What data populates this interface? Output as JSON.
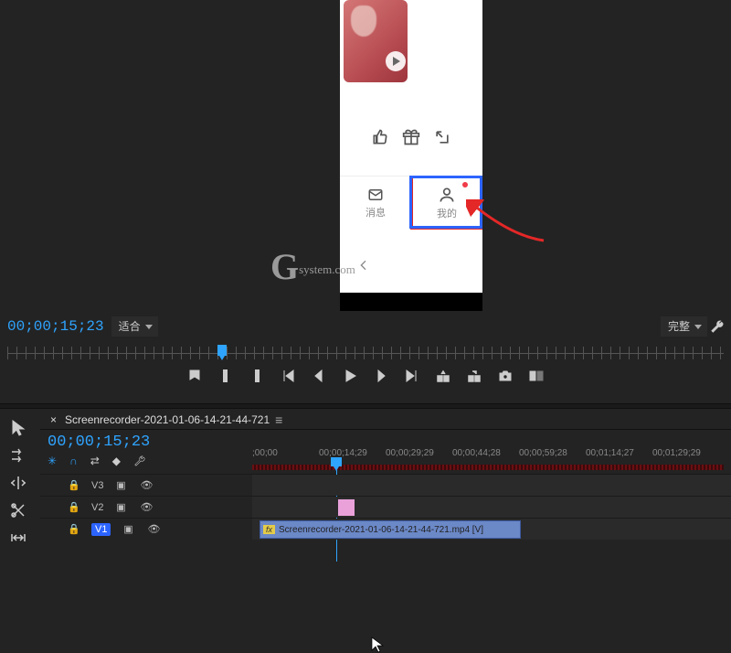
{
  "program": {
    "timecode": "00;00;15;23",
    "fit_label": "适合",
    "full_label": "完整",
    "nav_msg": "消息",
    "nav_mine": "我的",
    "watermark_main": "G",
    "watermark_sub": "system.com"
  },
  "transport": {
    "marker": "marker-icon",
    "in": "in-icon",
    "out": "out-icon",
    "goto_in": "goto-in-icon",
    "step_back": "step-back-icon",
    "play": "play-icon",
    "step_fwd": "step-fwd-icon",
    "goto_out": "goto-out-icon",
    "lift": "lift-icon",
    "extract": "extract-icon",
    "export_frame": "camera-icon",
    "compare": "compare-icon"
  },
  "timeline": {
    "sequence_name": "Screenrecorder-2021-01-06-14-21-44-721",
    "timecode": "00;00;15;23",
    "ruler": [
      ";00;00",
      "00;00;14;29",
      "00;00;29;29",
      "00;00;44;28",
      "00;00;59;28",
      "00;01;14;27",
      "00;01;29;29"
    ],
    "tracks": {
      "v3": "V3",
      "v2": "V2",
      "v1": "V1"
    },
    "clip_label": "Screenrecorder-2021-01-06-14-21-44-721.mp4 [V]",
    "fx_badge": "fx"
  },
  "icons": {
    "lock": "🔒",
    "eye": "👁",
    "film": "▭"
  }
}
